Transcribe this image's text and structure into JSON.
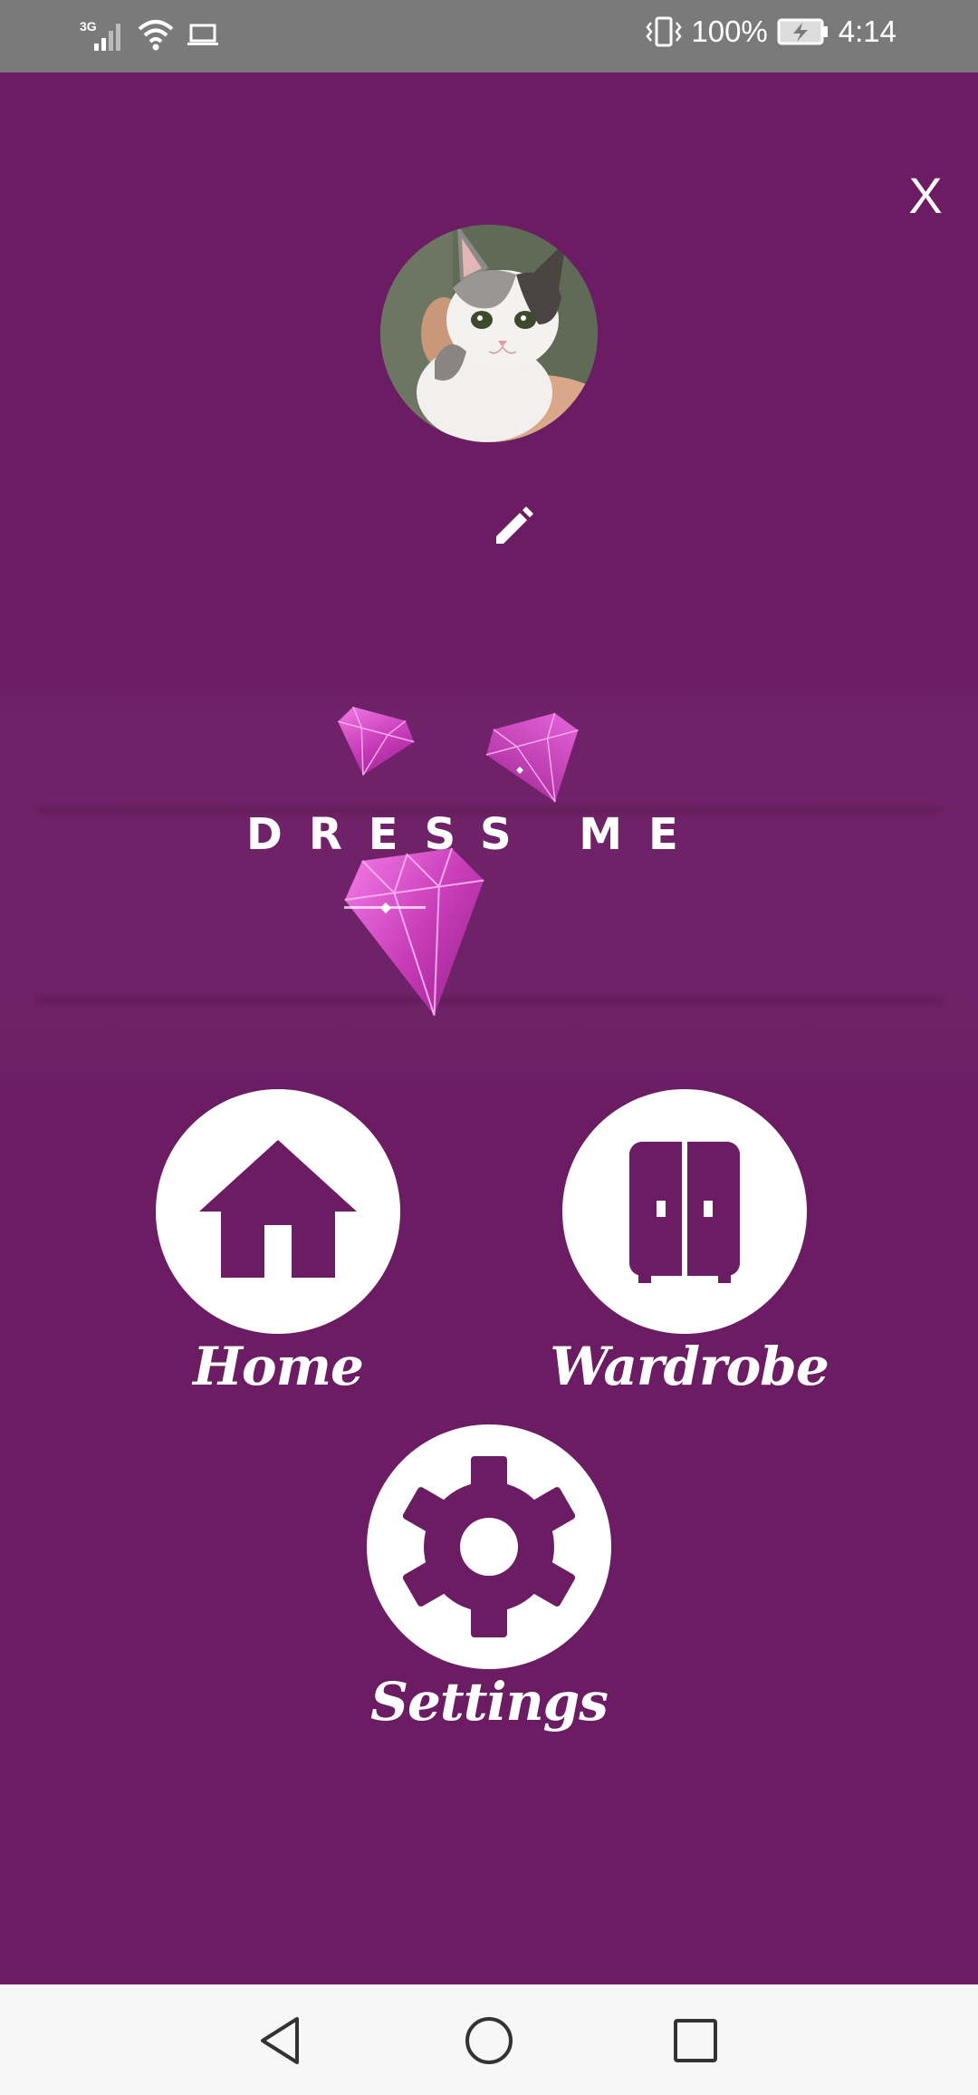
{
  "status_bar": {
    "network_label": "3G",
    "battery_percent": "100%",
    "time": "4:14",
    "icons": [
      "signal-icon",
      "wifi-icon",
      "laptop-icon",
      "vibrate-icon",
      "battery-charging-icon"
    ]
  },
  "drawer": {
    "close_label": "X",
    "avatar_icon": "cat-photo",
    "edit_icon": "pencil-icon"
  },
  "logo": {
    "text": "DRESS ME",
    "icon": "diamond-gems-icon"
  },
  "menu": {
    "home": {
      "label": "Home",
      "icon": "house-icon"
    },
    "wardrobe": {
      "label": "Wardrobe",
      "icon": "wardrobe-icon"
    },
    "settings": {
      "label": "Settings",
      "icon": "gear-icon"
    }
  },
  "nav_bar": {
    "icons": [
      "back-triangle-icon",
      "home-circle-icon",
      "recents-square-icon"
    ]
  },
  "colors": {
    "background": "#6b1c63",
    "status_bar": "#7a7a7a",
    "accent_white": "#ffffff",
    "nav_bar": "#f7f7f7"
  }
}
